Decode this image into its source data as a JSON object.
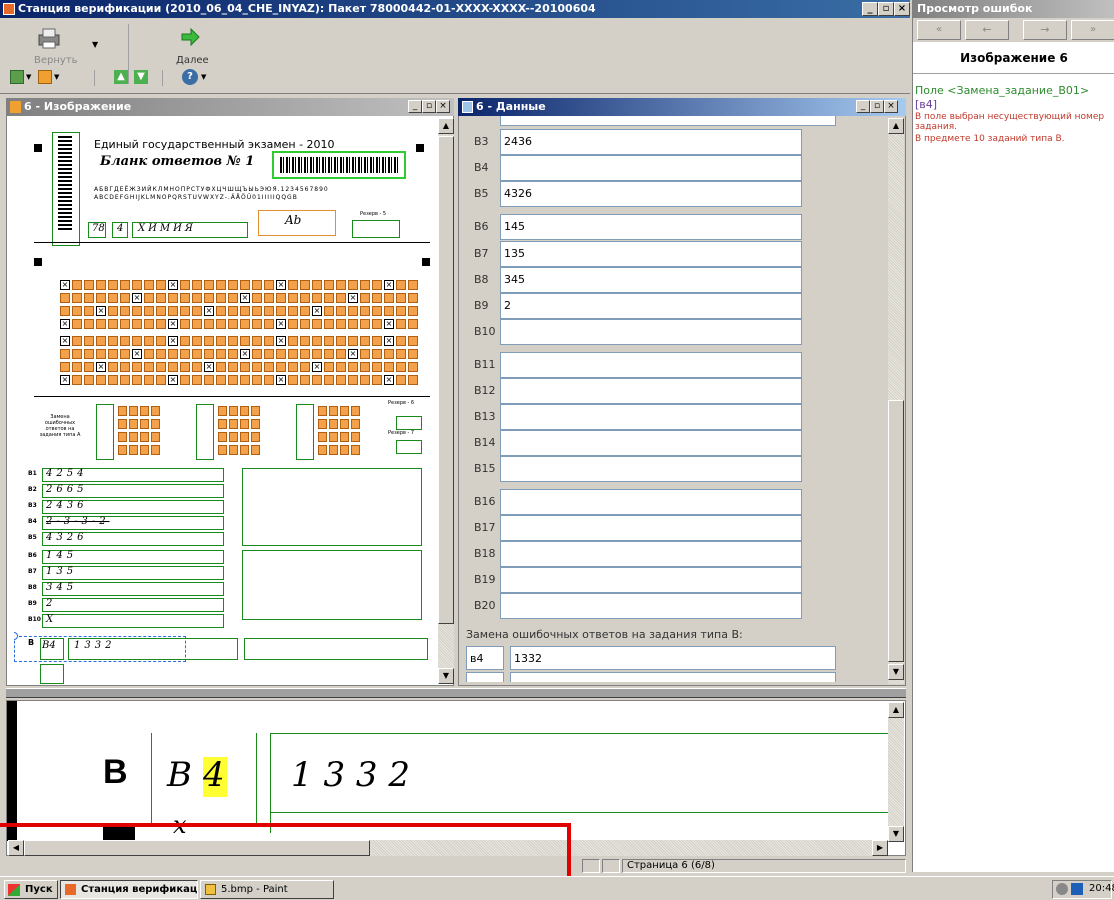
{
  "window": {
    "title": "Станция верификации (2010_06_04_CHE_INYAZ): Пакет 78000442-01-XXXX-XXXX--20100604"
  },
  "toolbar": {
    "back_label": "Вернуть",
    "next_label": "Далее"
  },
  "image_panel": {
    "title": "6 - Изображение",
    "form": {
      "header": "Единый государственный экзамен - 2010",
      "subheader": "Бланк ответов № 1",
      "alphabet1": "АБВГДЕЁЖЗИЙКЛМНОПРСТУФХЦЧШЩЪЫЬЭЮЯ.1234567890",
      "alphabet2": "ABCDEFGHIJKLMNOPQRSTUVWXYZ-.ÄÅÖÜ01IIIIIQQGB",
      "code1": "78",
      "code2": "4",
      "subject": "ХИМИЯ",
      "small_rezerv5": "Резерв - 5",
      "small_rezerv6": "Резерв - 6",
      "small_rezerv7": "Резерв - 7",
      "zamena_label": "Замена ошибочных ответов на задания типа А",
      "b_answers": [
        {
          "label": "B1",
          "value": "4254"
        },
        {
          "label": "B2",
          "value": "2665"
        },
        {
          "label": "B3",
          "value": "2436"
        },
        {
          "label": "B4",
          "value": "2-3-3-2"
        },
        {
          "label": "B5",
          "value": "4326"
        },
        {
          "label": "B6",
          "value": "145"
        },
        {
          "label": "B7",
          "value": "135"
        },
        {
          "label": "B8",
          "value": "345"
        },
        {
          "label": "B9",
          "value": "2"
        },
        {
          "label": "B10",
          "value": "X"
        }
      ],
      "replace_row": {
        "label": "B",
        "code": "B4",
        "value": "1332"
      }
    }
  },
  "data_panel": {
    "title": "6 - Данные",
    "rows": [
      {
        "label": "B3",
        "value": "2436"
      },
      {
        "label": "B4",
        "value": ""
      },
      {
        "label": "B5",
        "value": "4326"
      },
      {
        "label": "B6",
        "value": "145"
      },
      {
        "label": "B7",
        "value": "135"
      },
      {
        "label": "B8",
        "value": "345"
      },
      {
        "label": "B9",
        "value": "2"
      },
      {
        "label": "B10",
        "value": ""
      },
      {
        "label": "B11",
        "value": ""
      },
      {
        "label": "B12",
        "value": ""
      },
      {
        "label": "B13",
        "value": ""
      },
      {
        "label": "B14",
        "value": ""
      },
      {
        "label": "B15",
        "value": ""
      },
      {
        "label": "B16",
        "value": ""
      },
      {
        "label": "B17",
        "value": ""
      },
      {
        "label": "B18",
        "value": ""
      },
      {
        "label": "B19",
        "value": ""
      },
      {
        "label": "B20",
        "value": ""
      }
    ],
    "replace_heading": "Замена ошибочных ответов на задания типа В:",
    "replace_code": "в4",
    "replace_value": "1332"
  },
  "zoom": {
    "letter": "B",
    "code1": "B",
    "code2": "4",
    "value": "1 3 3 2"
  },
  "status": {
    "page": "Страница 6  (6/8)"
  },
  "error_panel": {
    "title": "Просмотр ошибок",
    "image_label": "Изображение 6",
    "field": "Поле <Замена_задание_В01>",
    "code": "[в4]",
    "msg1": "В поле выбран несуществующий номер задания.",
    "msg2": "В предмете 10 заданий типа В."
  },
  "taskbar": {
    "start": "Пуск",
    "app1": "Станция верификаци...",
    "app2": "5.bmp - Paint",
    "time": "20:48"
  },
  "colors": {
    "accent_title": "#0a246a",
    "form_green": "#1a8a1a",
    "form_orange": "#f3a14a",
    "error_red": "#c0392b",
    "field_green": "#2e8b2e",
    "annotation_red": "#e00000"
  }
}
